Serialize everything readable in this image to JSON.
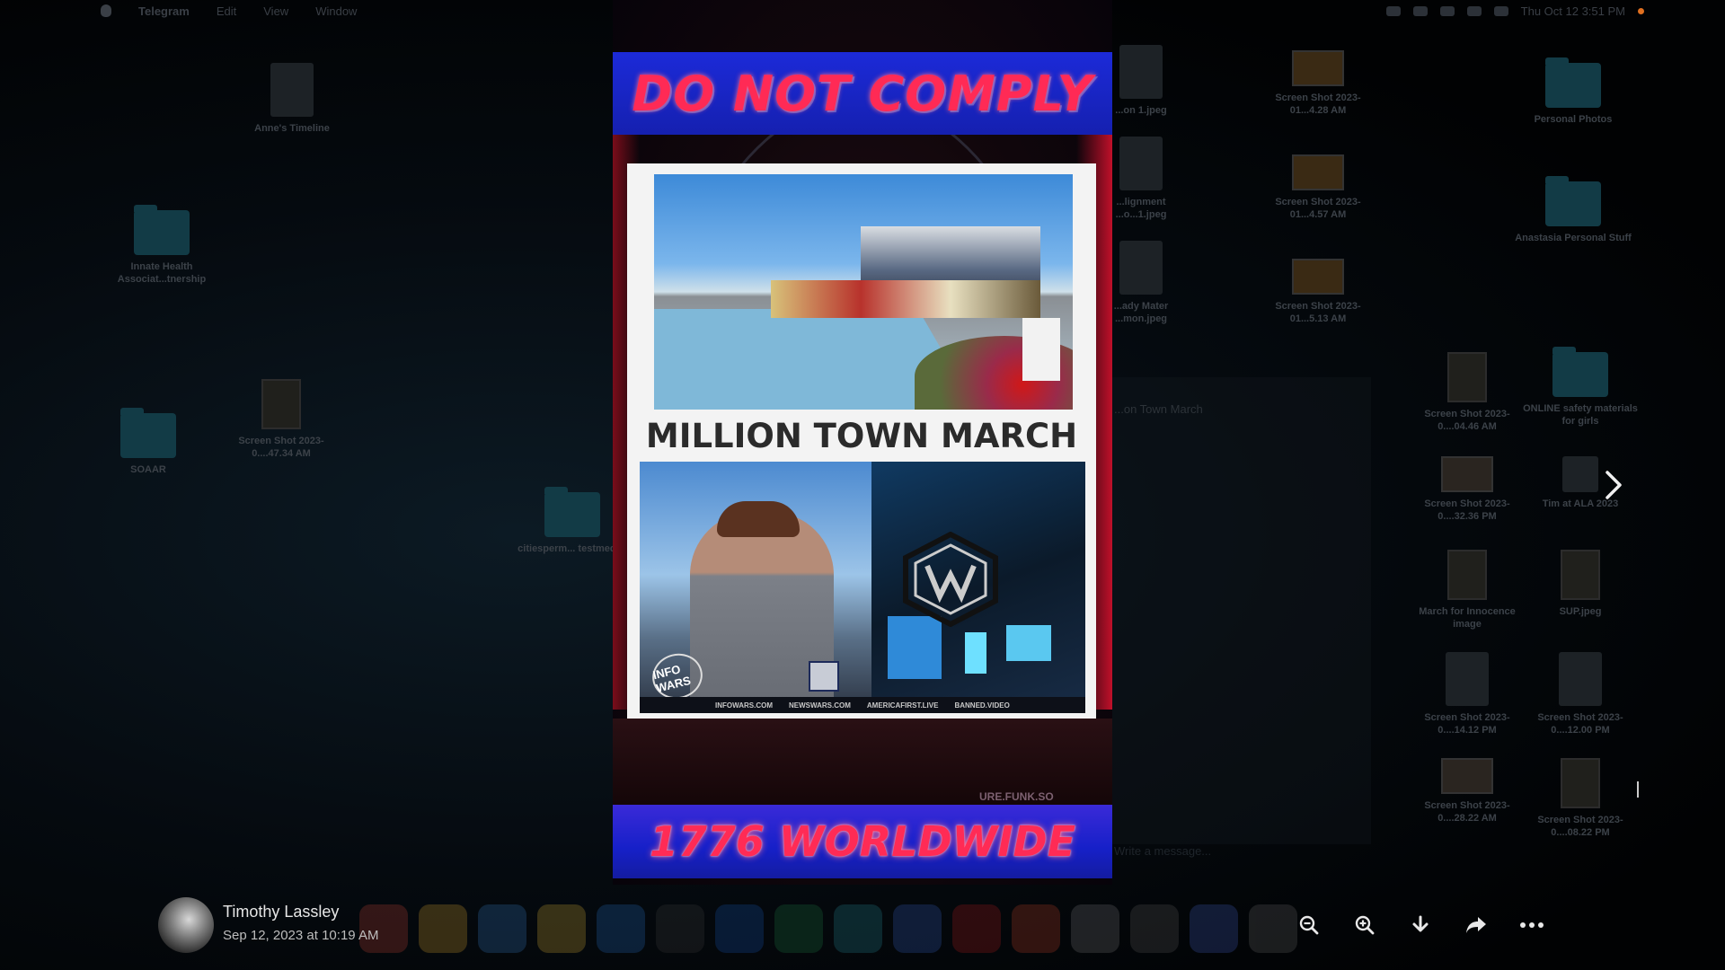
{
  "menubar": {
    "app_name": "Telegram",
    "items": [
      "Edit",
      "View",
      "Window"
    ],
    "clock": "Thu Oct 12  3:51 PM"
  },
  "desktop": {
    "items": [
      {
        "label": "Anne's Timeline",
        "kind": "doc"
      },
      {
        "label": "Innate Health Associat...tnership",
        "kind": "folder"
      },
      {
        "label": "SOAAR",
        "kind": "folder"
      },
      {
        "label": "Screen Shot 2023-0....47.34 AM",
        "kind": "portrait"
      },
      {
        "label": "citiesperm... testmedi...",
        "kind": "folder"
      },
      {
        "label": "...on 1.jpeg",
        "kind": "doc"
      },
      {
        "label": "...lignment ...o...1.jpeg",
        "kind": "doc"
      },
      {
        "label": "...ady Mater ...mon.jpeg",
        "kind": "doc"
      },
      {
        "label": "Screen Shot 2023-01...4.28 AM",
        "kind": "shot"
      },
      {
        "label": "Screen Shot 2023-01...4.57 AM",
        "kind": "shot"
      },
      {
        "label": "Screen Shot 2023-01...5.13 AM",
        "kind": "shot"
      },
      {
        "label": "Personal Photos",
        "kind": "folder"
      },
      {
        "label": "Anastasia Personal Stuff",
        "kind": "folder"
      },
      {
        "label": "Screen Shot 2023-0....04.46 AM",
        "kind": "portrait"
      },
      {
        "label": "ONLINE safety materials for girls",
        "kind": "folder"
      },
      {
        "label": "Screen Shot 2023-0....32.36 PM",
        "kind": "shot"
      },
      {
        "label": "Tim at ALA 2023",
        "kind": "doc"
      },
      {
        "label": "March for Innocence image",
        "kind": "portrait"
      },
      {
        "label": "SUP.jpeg",
        "kind": "portrait"
      },
      {
        "label": "Screen Shot 2023-0....14.12 PM",
        "kind": "doc"
      },
      {
        "label": "Screen Shot 2023-0....12.00 PM",
        "kind": "doc"
      },
      {
        "label": "Screen Shot 2023-0....28.22 AM",
        "kind": "shot"
      },
      {
        "label": "Screen Shot 2023-0....08.22 PM",
        "kind": "portrait"
      }
    ]
  },
  "background_chat": {
    "title": "...on Town March",
    "message_placeholder": "Write a message..."
  },
  "media": {
    "top_banner": "DO NOT COMPLY",
    "headline": "MILLION TOWN MARCH",
    "channel_logo": "INFO WARS",
    "ticker": [
      "INFOWARS.COM",
      "NEWSWARS.COM",
      "AMERICAFIRST.LIVE",
      "BANNED.VIDEO"
    ],
    "watermark": "URE.FUNK.SO",
    "bottom_banner": "1776 WORLDWIDE"
  },
  "sender": {
    "name": "Timothy Lassley",
    "date": "Sep 12, 2023 at 10:19 AM"
  },
  "icons": {
    "next": "chevron-right-icon",
    "zoom_out": "zoom-out-icon",
    "zoom_in": "zoom-in-icon",
    "download": "download-icon",
    "forward": "forward-icon",
    "more": "more-icon"
  },
  "colors": {
    "banner_blue": "#1c2ad8",
    "banner_text": "#ff2a55",
    "poster_bg": "#f3f3f3"
  }
}
